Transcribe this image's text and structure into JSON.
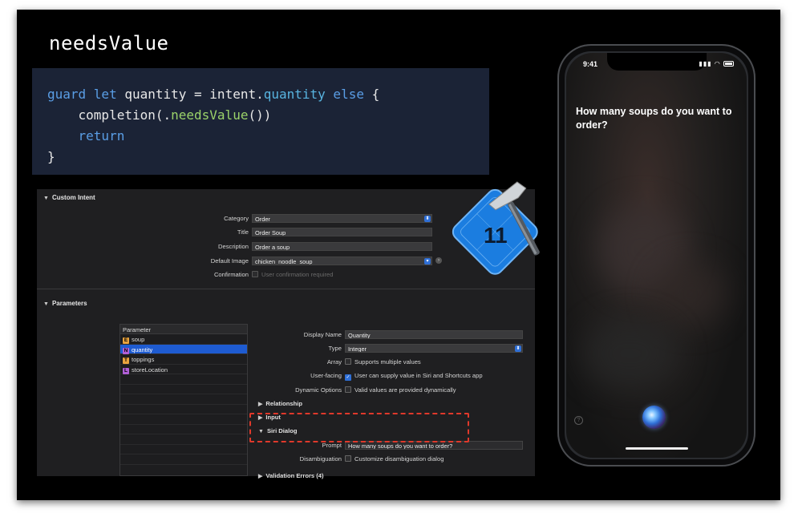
{
  "slide": {
    "title": "needsValue"
  },
  "code": {
    "line1": {
      "kw1": "guard let",
      "id1": " quantity = intent.",
      "prop": "quantity",
      "kw2": " else",
      "tail": " {"
    },
    "line2": {
      "pre": "    completion(.",
      "fn": "needsValue",
      "post": "())"
    },
    "line3": {
      "kw": "    return"
    },
    "line4": "}"
  },
  "xcode": {
    "custom_intent_header": "Custom Intent",
    "category_label": "Category",
    "category_value": "Order",
    "title_label": "Title",
    "title_value": "Order Soup",
    "description_label": "Description",
    "description_value": "Order a soup",
    "default_image_label": "Default Image",
    "default_image_value": "chicken_noodle_soup",
    "confirmation_label": "Confirmation",
    "confirmation_text": "User confirmation required",
    "parameters_header": "Parameters",
    "parameter_list_header": "Parameter",
    "parameters": [
      {
        "badge": "E",
        "name": "soup",
        "color": "#e8a33d"
      },
      {
        "badge": "N",
        "name": "quantity",
        "color": "#b05fd6"
      },
      {
        "badge": "T",
        "name": "toppings",
        "color": "#e8a33d"
      },
      {
        "badge": "L",
        "name": "storeLocation",
        "color": "#b05fd6"
      }
    ],
    "display_name_label": "Display Name",
    "display_name_value": "Quantity",
    "type_label": "Type",
    "type_value": "Integer",
    "array_label": "Array",
    "array_text": "Supports multiple values",
    "user_facing_label": "User-facing",
    "user_facing_text": "User can supply value in Siri and Shortcuts app",
    "dynamic_options_label": "Dynamic Options",
    "dynamic_options_text": "Valid values are provided dynamically",
    "relationship_header": "Relationship",
    "input_header": "Input",
    "siri_dialog_header": "Siri Dialog",
    "prompt_label": "Prompt",
    "prompt_value": "How many soups do you want to order?",
    "disambiguation_label": "Disambiguation",
    "disambiguation_text": "Customize disambiguation dialog",
    "validation_errors_header": "Validation Errors (4)"
  },
  "xcode_icon": {
    "version": "11"
  },
  "phone": {
    "time": "9:41",
    "siri_prompt": "How many soups do you want to order?",
    "help_glyph": "?"
  },
  "colors": {
    "accent_blue": "#1e5bd1",
    "highlight_red": "#e0392b",
    "code_bg": "#1b2336"
  }
}
